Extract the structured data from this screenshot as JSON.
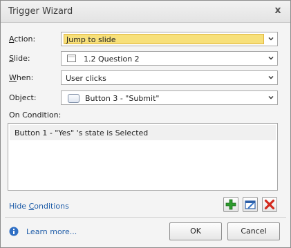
{
  "window": {
    "title": "Trigger Wizard",
    "close_glyph": "x"
  },
  "fields": {
    "action": {
      "label_accel": "A",
      "label_rest": "ction:",
      "value": "Jump to slide"
    },
    "slide": {
      "label_accel": "S",
      "label_rest": "lide:",
      "value": "1.2 Question 2",
      "icon": "slide-thumbnail-icon"
    },
    "when": {
      "label_accel": "W",
      "label_rest": "hen:",
      "value": "User clicks"
    },
    "object": {
      "label_pre": "Ob",
      "label_accel": "j",
      "label_rest": "ect:",
      "value": "Button 3 - \"Submit\"",
      "icon": "button-object-icon"
    }
  },
  "conditions": {
    "label": "On Condition:",
    "items": [
      {
        "text": "Button 1 - \"Yes\" 's state is Selected"
      }
    ],
    "hide_link_pre": "Hide ",
    "hide_link_accel": "C",
    "hide_link_rest": "onditions"
  },
  "condition_tools": {
    "add_icon": "add-condition-icon",
    "edit_icon": "edit-condition-icon",
    "delete_icon": "delete-condition-icon",
    "colors": {
      "add": "#2e9c2e",
      "edit": "#2c5fa8",
      "delete": "#d32a1e"
    }
  },
  "footer": {
    "learn_more": "Learn more...",
    "info_icon": "info-icon",
    "ok_label": "OK",
    "cancel_label": "Cancel"
  },
  "colors": {
    "highlight": "#f7e07a",
    "link": "#1e5ca8"
  }
}
